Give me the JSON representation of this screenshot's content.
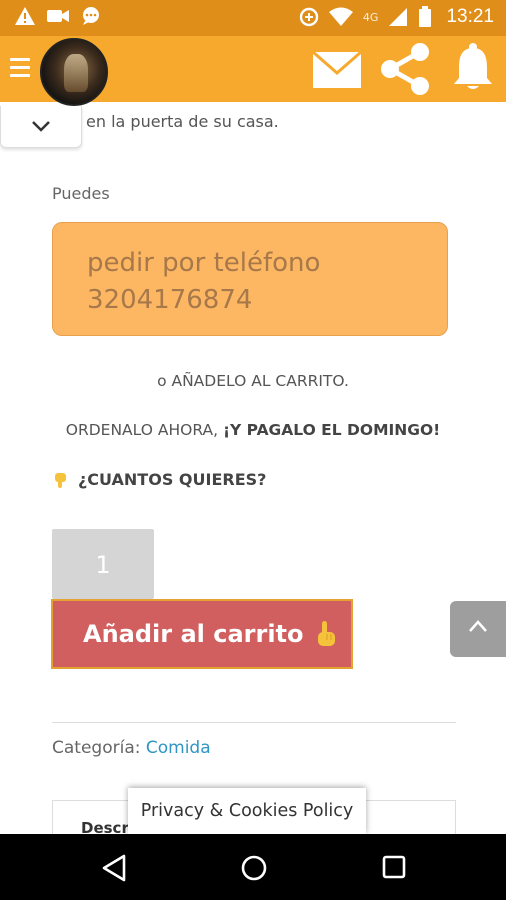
{
  "status_bar": {
    "time": "13:21",
    "network": "4G",
    "icons": [
      "warning-icon",
      "camera-icon",
      "message-icon",
      "data-saver-icon",
      "wifi-icon",
      "signal-icon",
      "battery-icon"
    ]
  },
  "app_bar": {
    "icons": [
      "menu-icon",
      "avatar",
      "mail-icon",
      "share-icon",
      "bell-icon"
    ],
    "color": "#f7a92d"
  },
  "content": {
    "intro_text": "en la puerta de su casa.",
    "puedes": "Puedes",
    "phone_line1": "pedir por teléfono",
    "phone_line2": "3204176874",
    "or_add": "o AÑADELO AL CARRITO.",
    "order_now_prefix": "ORDENALO AHORA, ",
    "order_now_bold": "¡Y PAGALO EL DOMINGO!",
    "how_many": "¿CUANTOS QUIERES?",
    "quantity": "1",
    "add_to_cart": "Añadir al carrito",
    "category_label": "Categoría: ",
    "category_link": "Comida",
    "tab_label": "Descr"
  },
  "privacy": {
    "label": "Privacy & Cookies Policy"
  },
  "colors": {
    "accent": "#f7a92d",
    "phone_box": "#fdb763",
    "cart_button": "#d15f5f",
    "link": "#2f95c4"
  }
}
